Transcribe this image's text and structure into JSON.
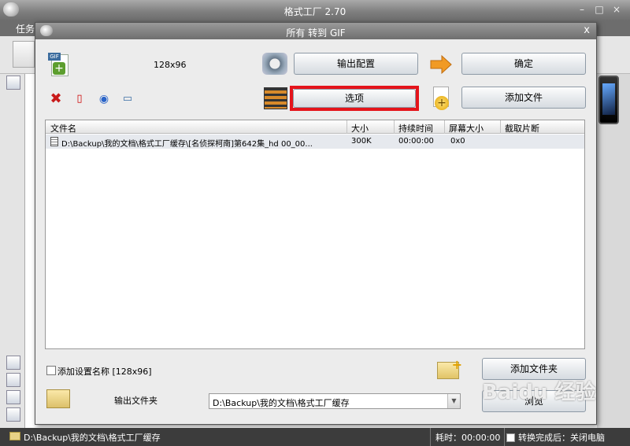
{
  "app": {
    "title": "格式工厂 2.70",
    "menu_label": "任务",
    "min_label": "–",
    "max_label": "□",
    "close_label": "×"
  },
  "dialog": {
    "title": "所有 转到 GIF",
    "close_label": "x",
    "size_label": "128x96",
    "output_config_button": "输出配置",
    "ok_button": "确定",
    "options_button": "选项",
    "add_file_button": "添加文件",
    "table": {
      "columns": [
        "文件名",
        "大小",
        "持续时间",
        "屏幕大小",
        "截取片断"
      ],
      "rows": [
        {
          "name": "D:\\Backup\\我的文档\\格式工厂缓存\\[名侦探柯南]第642集_hd 00_00...",
          "size": "300K",
          "duration": "00:00:00",
          "screen": "0x0",
          "clip": ""
        }
      ]
    },
    "add_setting_name_label": "添加设置名称 [128x96]",
    "add_folder_button": "添加文件夹",
    "output_folder_label": "输出文件夹",
    "output_folder_path": "D:\\Backup\\我的文档\\格式工厂缓存",
    "browse_button": "浏览"
  },
  "status": {
    "path": "D:\\Backup\\我的文档\\格式工厂缓存",
    "elapsed": "耗时：00:00:00",
    "after_done": "转换完成后：关闭电脑"
  },
  "watermark": "Baidu 经验",
  "colors": {
    "highlight": "#e4141b",
    "title_bar": "#7d7d7d"
  }
}
